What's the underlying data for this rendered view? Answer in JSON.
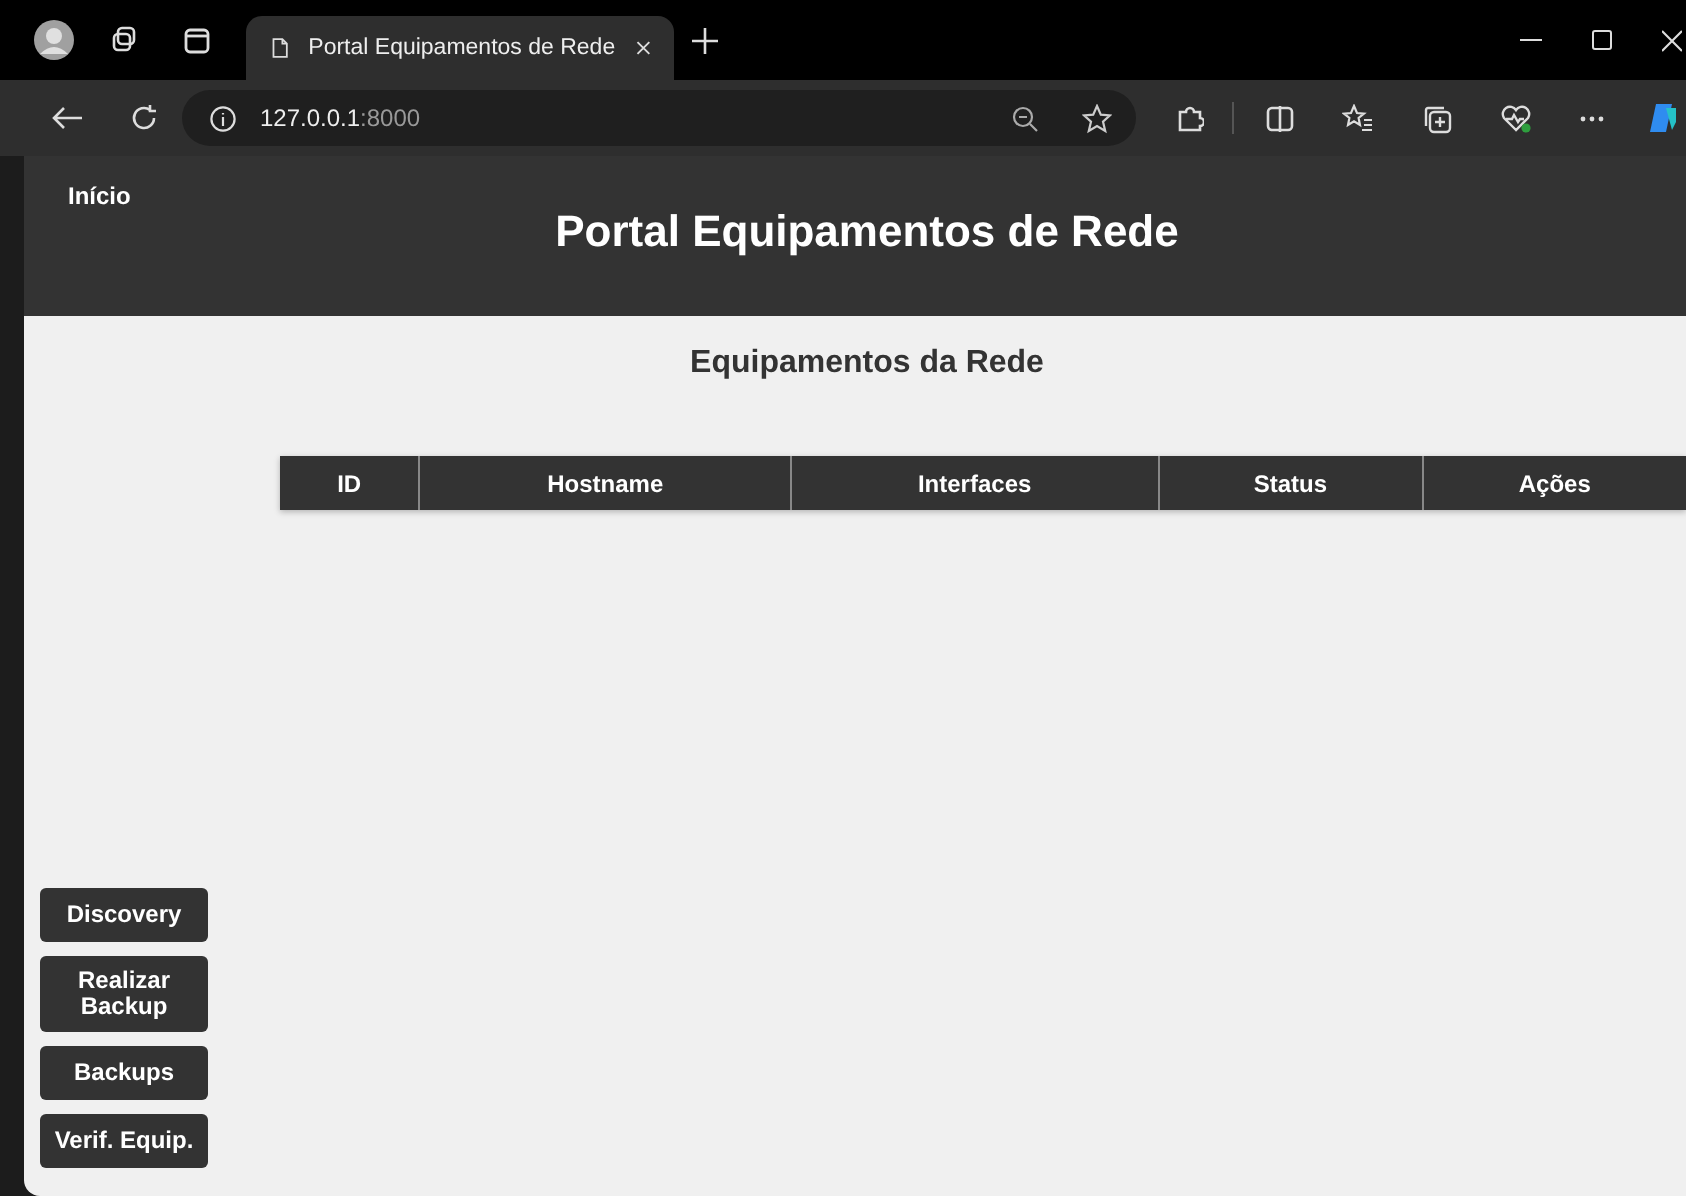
{
  "browser": {
    "tab_title": "Portal Equipamentos de Rede",
    "url_host": "127.0.0.1",
    "url_port": ":8000"
  },
  "header": {
    "nav_link": "Início",
    "title": "Portal Equipamentos de Rede"
  },
  "section_title": "Equipamentos da Rede",
  "table": {
    "columns": [
      "ID",
      "Hostname",
      "Interfaces",
      "Status",
      "Ações"
    ]
  },
  "sidebar_buttons": [
    "Discovery",
    "Realizar Backup",
    "Backups",
    "Verif. Equip."
  ]
}
